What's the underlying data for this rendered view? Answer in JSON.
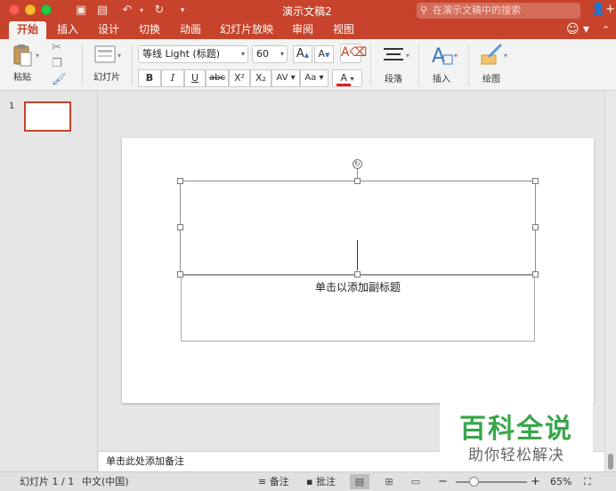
{
  "titlebar": {
    "title": "演示文稿2",
    "search_placeholder": "在演示文稿中的搜索"
  },
  "tabs": [
    "开始",
    "插入",
    "设计",
    "切换",
    "动画",
    "幻灯片放映",
    "审阅",
    "视图"
  ],
  "ribbon": {
    "paste_label": "粘贴",
    "slides_label": "幻灯片",
    "font_name": "等线 Light (标题)",
    "font_size": "60",
    "grow_font": "A",
    "shrink_font": "A",
    "bold": "B",
    "italic": "I",
    "underline": "U",
    "strike": "abc",
    "superscript": "X²",
    "subscript": "X₂",
    "spacing": "AV",
    "change_case": "Aa",
    "font_color": "A",
    "paragraph_label": "段落",
    "insert_label": "插入",
    "draw_label": "绘图"
  },
  "thumbnails": {
    "current_number": "1"
  },
  "slide": {
    "subtitle_placeholder": "单击以添加副标题"
  },
  "notes": {
    "placeholder": "单击此处添加备注"
  },
  "watermark": {
    "title": "百科全说",
    "subtitle": "助你轻松解决"
  },
  "statusbar": {
    "slide_info": "幻灯片 1 / 1",
    "language": "中文(中国)",
    "notes_label": "备注",
    "comments_label": "批注",
    "zoom_level": "65%"
  },
  "colors": {
    "accent": "#c7432b",
    "font_color_bar": "#e11d1d",
    "watermark_green": "#3aa54a"
  },
  "icons": [
    "save-icon",
    "undo-icon",
    "redo-icon",
    "customize-icon",
    "search-icon",
    "share-icon",
    "smiley-icon",
    "paste-icon",
    "cut-icon",
    "copy-icon",
    "format-painter-icon",
    "slide-layout-icon",
    "clear-format-icon",
    "paragraph-icon",
    "insert-shape-icon",
    "draw-brush-icon",
    "notes-icon",
    "comments-icon",
    "normal-view-icon",
    "slide-sorter-icon",
    "reading-view-icon",
    "fit-window-icon"
  ]
}
